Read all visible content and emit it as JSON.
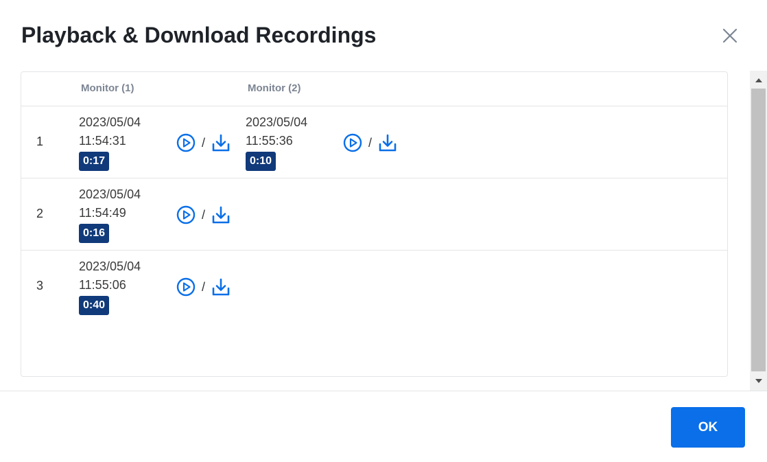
{
  "dialog": {
    "title": "Playback & Download Recordings",
    "close_icon": "close-icon",
    "ok_label": "OK",
    "accent_color": "#0a6fe8",
    "badge_color": "#103a7a"
  },
  "table": {
    "columns": [
      "Monitor (1)",
      "Monitor (2)"
    ],
    "action_separator": "/",
    "rows": [
      {
        "index": "1",
        "monitors": [
          {
            "date": "2023/05/04",
            "time": "11:54:31",
            "duration": "0:17"
          },
          {
            "date": "2023/05/04",
            "time": "11:55:36",
            "duration": "0:10"
          }
        ]
      },
      {
        "index": "2",
        "monitors": [
          {
            "date": "2023/05/04",
            "time": "11:54:49",
            "duration": "0:16"
          }
        ]
      },
      {
        "index": "3",
        "monitors": [
          {
            "date": "2023/05/04",
            "time": "11:55:06",
            "duration": "0:40"
          }
        ]
      }
    ]
  },
  "icons": {
    "play": "play-circle-icon",
    "download": "download-icon",
    "scroll_up": "scroll-up-arrow-icon",
    "scroll_down": "scroll-down-arrow-icon"
  }
}
